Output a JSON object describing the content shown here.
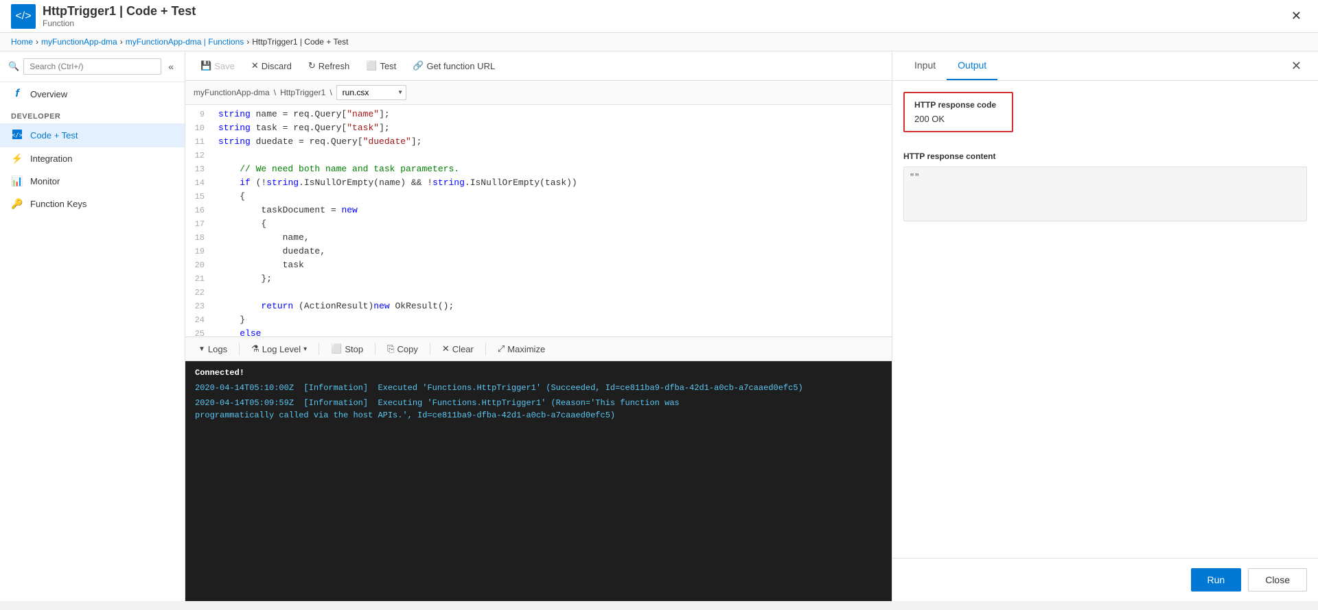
{
  "topbar": {
    "icon": "</>",
    "title": "HttpTrigger1 | Code + Test",
    "subtitle": "Function"
  },
  "breadcrumb": {
    "items": [
      "Home",
      "myFunctionApp-dma",
      "myFunctionApp-dma | Functions",
      "HttpTrigger1 | Code + Test"
    ]
  },
  "sidebar": {
    "search_placeholder": "Search (Ctrl+/)",
    "collapse_icon": "«",
    "developer_label": "Developer",
    "nav_items": [
      {
        "id": "overview",
        "label": "Overview",
        "icon": "f",
        "active": false
      },
      {
        "id": "code-test",
        "label": "Code + Test",
        "icon": "code",
        "active": true
      },
      {
        "id": "integration",
        "label": "Integration",
        "icon": "integration",
        "active": false
      },
      {
        "id": "monitor",
        "label": "Monitor",
        "icon": "monitor",
        "active": false
      },
      {
        "id": "function-keys",
        "label": "Function Keys",
        "icon": "keys",
        "active": false
      }
    ]
  },
  "toolbar": {
    "save_label": "Save",
    "discard_label": "Discard",
    "refresh_label": "Refresh",
    "test_label": "Test",
    "get_function_url_label": "Get function URL"
  },
  "file_path": {
    "app": "myFunctionApp-dma",
    "trigger": "HttpTrigger1",
    "file": "run.csx"
  },
  "code": {
    "lines": [
      {
        "num": 9,
        "content": "    string name = req.Query[\"name\"];",
        "tokens": [
          {
            "t": "kw",
            "v": "string"
          },
          {
            "t": "",
            "v": " name = req.Query["
          },
          {
            "t": "str",
            "v": "\"name\""
          },
          {
            "t": "",
            "v": "];"
          }
        ]
      },
      {
        "num": 10,
        "content": "    string task = req.Query[\"task\"];",
        "tokens": [
          {
            "t": "kw",
            "v": "string"
          },
          {
            "t": "",
            "v": " task = req.Query["
          },
          {
            "t": "str",
            "v": "\"task\""
          },
          {
            "t": "",
            "v": "];"
          }
        ]
      },
      {
        "num": 11,
        "content": "    string duedate = req.Query[\"duedate\"];",
        "tokens": [
          {
            "t": "kw",
            "v": "string"
          },
          {
            "t": "",
            "v": " duedate = req.Query["
          },
          {
            "t": "str",
            "v": "\"duedate\""
          },
          {
            "t": "",
            "v": "];"
          }
        ]
      },
      {
        "num": 12,
        "content": ""
      },
      {
        "num": 13,
        "content": "    // We need both name and task parameters.",
        "tokens": [
          {
            "t": "cm",
            "v": "    // We need both name and task parameters."
          }
        ]
      },
      {
        "num": 14,
        "content": "    if (!string.IsNullOrEmpty(name) && !string.IsNullOrEmpty(task))",
        "tokens": [
          {
            "t": "kw",
            "v": "    if"
          },
          {
            "t": "",
            "v": " (!"
          },
          {
            "t": "kw",
            "v": "string"
          },
          {
            "t": "",
            "v": ".IsNullOrEmpty(name) && !"
          },
          {
            "t": "kw",
            "v": "string"
          },
          {
            "t": "",
            "v": ".IsNullOrEmpty(task))"
          }
        ]
      },
      {
        "num": 15,
        "content": "    {"
      },
      {
        "num": 16,
        "content": "        taskDocument = new"
      },
      {
        "num": 17,
        "content": "        {"
      },
      {
        "num": 18,
        "content": "            name,"
      },
      {
        "num": 19,
        "content": "            duedate,"
      },
      {
        "num": 20,
        "content": "            task"
      },
      {
        "num": 21,
        "content": "        };"
      },
      {
        "num": 22,
        "content": ""
      },
      {
        "num": 23,
        "content": "        return (ActionResult)new OkResult();",
        "tokens": [
          {
            "t": "kw",
            "v": "        return"
          },
          {
            "t": "",
            "v": " (ActionResult)"
          },
          {
            "t": "kw",
            "v": "new"
          },
          {
            "t": "",
            "v": " OkResult();"
          }
        ]
      },
      {
        "num": 24,
        "content": "    }"
      },
      {
        "num": 25,
        "content": "    else"
      }
    ]
  },
  "logs": {
    "logs_label": "Logs",
    "log_level_label": "Log Level",
    "stop_label": "Stop",
    "copy_label": "Copy",
    "clear_label": "Clear",
    "maximize_label": "Maximize",
    "connected_text": "Connected!",
    "entries": [
      "2020-04-14T05:10:00Z  [Information]  Executed 'Functions.HttpTrigger1' (Succeeded, Id=ce811ba9-dfba-42d1-a0cb-a7caaed0efc5)",
      "2020-04-14T05:09:59Z  [Information]  Executing 'Functions.HttpTrigger1' (Reason='This function was programmatically called via the host APIs.', Id=ce811ba9-dfba-42d1-a0cb-a7caaed0efc5)"
    ]
  },
  "right_panel": {
    "input_tab_label": "Input",
    "output_tab_label": "Output",
    "active_tab": "Output",
    "http_response_code_label": "HTTP response code",
    "http_response_code_value": "200 OK",
    "http_content_label": "HTTP response content",
    "http_content_value": "\"\"",
    "run_label": "Run",
    "close_label": "Close"
  }
}
